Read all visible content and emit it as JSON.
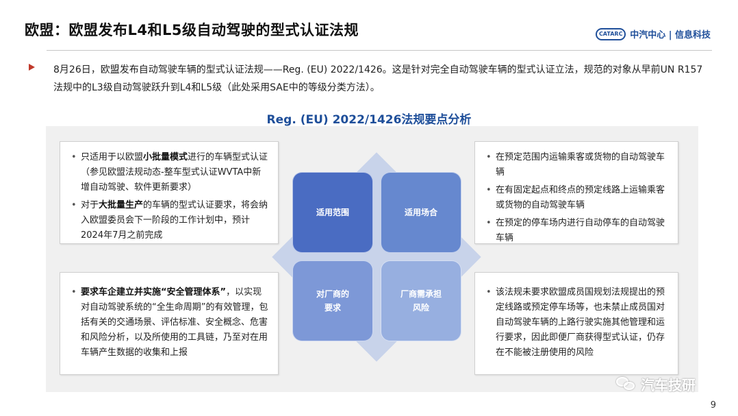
{
  "header": {
    "title": "欧盟：欧盟发布L4和L5级自动驾驶的型式认证法规",
    "brand_logo": "CATARC",
    "brand_text": "中汽中心 | 信息科技"
  },
  "intro": "8月26日，欧盟发布自动驾驶车辆的型式认证法规——Reg. (EU) 2022/1426。这是针对完全自动驾驶车辆的型式认证立法，规范的对象从早前UN R157法规中的L3级自动驾驶跃升到L4和L5级（此处采用SAE中的等级分类方法）。",
  "analysis": {
    "title": "Reg. (EU) 2022/1426法规要点分析",
    "quadrants": {
      "scope": "适用范围",
      "scenarios": "适用场合",
      "requirements_line1": "对厂商的",
      "requirements_line2": "要求",
      "risk_line1": "厂商需承担",
      "risk_line2": "风险"
    },
    "scope_card": {
      "item1_pre": "只适用于以欧盟",
      "item1_bold": "小批量模式",
      "item1_post": "进行的车辆型式认证（参见欧盟法规动态-整车型式认证WVTA中新增自动驾驶、软件更新要求）",
      "item2_pre": "对于",
      "item2_bold": "大批量生产",
      "item2_post": "的车辆的型式认证要求，将会纳入欧盟委员会下一阶段的工作计划中，预计2024年7月之前完成"
    },
    "scenario_card": {
      "item1": "在预定范围内运输乘客或货物的自动驾驶车辆",
      "item2": "在有固定起点和终点的预定线路上运输乘客或货物的自动驾驶车辆",
      "item3": "在预定的停车场内进行自动停车的自动驾驶车辆"
    },
    "requirement_card": {
      "item1_bold": "要求车企建立并实施“安全管理体系”",
      "item1_post": "，以实现对自动驾驶系统的“全生命周期”的有效管理，包括有关的交通场景、评估标准、安全概念、危害和风险分析，以及所使用的工具链，乃至对在用车辆产生数据的收集和上报"
    },
    "risk_card": {
      "item1": "该法规未要求欧盟成员国规划法规提出的预定线路或预定停车场等，也未禁止成员国对自动驾驶车辆的上路行驶实施其他管理和运行要求，因此即便厂商获得型式认证，仍存在不能被注册使用的风险"
    }
  },
  "watermark": "汽车技研",
  "page_number": "9",
  "colors": {
    "title_blue": "#1f4f9a",
    "bullet_red": "#c0392b",
    "quad_1": "#4a6cc2",
    "quad_2": "#6688cf",
    "quad_3": "#7d98d7",
    "quad_4": "#97afe0"
  }
}
